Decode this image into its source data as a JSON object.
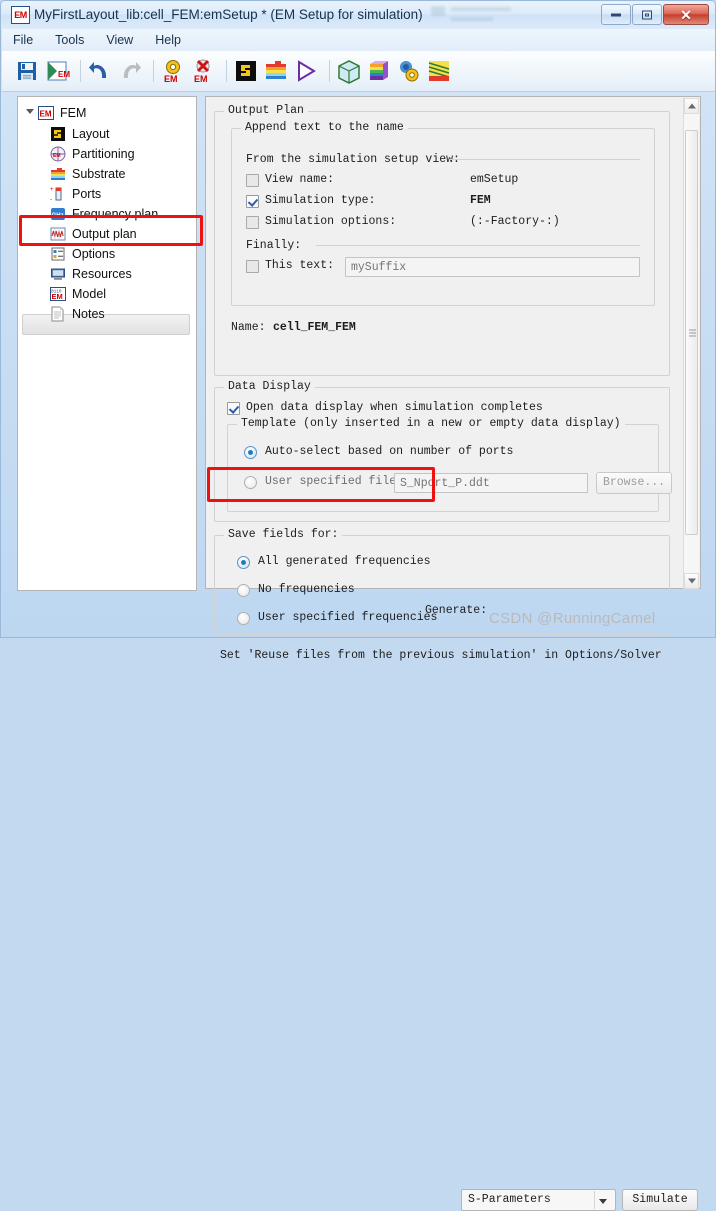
{
  "window": {
    "title": "MyFirstLayout_lib:cell_FEM:emSetup * (EM Setup for simulation)",
    "app_icon": "EM",
    "buttons": {
      "minimize": "minimize-icon",
      "maximize": "maximize-icon",
      "close": "✕"
    }
  },
  "menu": {
    "items": [
      "File",
      "Tools",
      "View",
      "Help"
    ]
  },
  "toolbar": {
    "items": [
      {
        "name": "save-icon"
      },
      {
        "name": "save-em-icon"
      },
      {
        "name": "undo-icon"
      },
      {
        "name": "redo-icon"
      },
      {
        "name": "em-settings-icon"
      },
      {
        "name": "em-delete-icon"
      },
      {
        "name": "layout-icon"
      },
      {
        "name": "substrate-icon"
      },
      {
        "name": "simulate-play-icon"
      },
      {
        "name": "3d-view-icon"
      },
      {
        "name": "rainbow-cube-icon"
      },
      {
        "name": "model-settings-icon"
      },
      {
        "name": "field-visual-icon"
      }
    ]
  },
  "tree": {
    "root": {
      "label": "FEM",
      "icon": "EM"
    },
    "items": [
      {
        "label": "Layout",
        "icon": "layout-icon"
      },
      {
        "label": "Partitioning",
        "icon": "partitioning-icon"
      },
      {
        "label": "Substrate",
        "icon": "substrate-icon"
      },
      {
        "label": "Ports",
        "icon": "ports-icon"
      },
      {
        "label": "Frequency plan",
        "icon": "ghz-icon"
      },
      {
        "label": "Output plan",
        "icon": "output-plan-icon",
        "selected": true,
        "highlighted": true
      },
      {
        "label": "Options",
        "icon": "options-icon"
      },
      {
        "label": "Resources",
        "icon": "resources-icon"
      },
      {
        "label": "Model",
        "icon": "model-icon"
      },
      {
        "label": "Notes",
        "icon": "notes-icon"
      }
    ]
  },
  "output_plan": {
    "group_title": "Output Plan",
    "append": {
      "group_title": "Append text to the name",
      "from_view_label": "From the simulation setup view:",
      "rows": [
        {
          "label": "View name:",
          "value": "emSetup",
          "checked": false
        },
        {
          "label": "Simulation type:",
          "value": "FEM",
          "checked": true
        },
        {
          "label": "Simulation options:",
          "value": "(:-Factory-:)",
          "checked": false
        }
      ],
      "finally_label": "Finally:",
      "this_text": {
        "label": "This text:",
        "checked": false,
        "placeholder": "mySuffix",
        "value": ""
      }
    },
    "name_label": "Name:",
    "name_value": "cell_FEM_FEM",
    "data_display": {
      "group_title": "Data Display",
      "open_on_complete": {
        "label": "Open data display when simulation completes",
        "checked": true
      },
      "template": {
        "group_title": "Template (only inserted in a new or empty data display)",
        "options": [
          {
            "label": "Auto-select based on number of ports",
            "selected": true
          },
          {
            "label": "User specified file",
            "selected": false
          }
        ],
        "file_placeholder": "S_Nport_P.ddt",
        "browse_label": "Browse..."
      }
    },
    "save_fields": {
      "group_title": "Save fields for:",
      "options": [
        {
          "label": "All generated frequencies",
          "selected": true,
          "highlighted": true
        },
        {
          "label": "No frequencies",
          "selected": false
        },
        {
          "label": "User specified frequencies",
          "selected": false
        }
      ]
    },
    "hint": "Set 'Reuse files from the previous simulation' in Options/Solver"
  },
  "footer": {
    "generate_label": "Generate:",
    "generate_value": "S-Parameters",
    "simulate_label": "Simulate"
  },
  "watermark": "CSDN @RunningCamel",
  "colors": {
    "highlight_red": "#ee1111",
    "accent_blue": "#1a7fc1",
    "panel_bg": "#f0f0f0",
    "title_text": "#16324f"
  }
}
